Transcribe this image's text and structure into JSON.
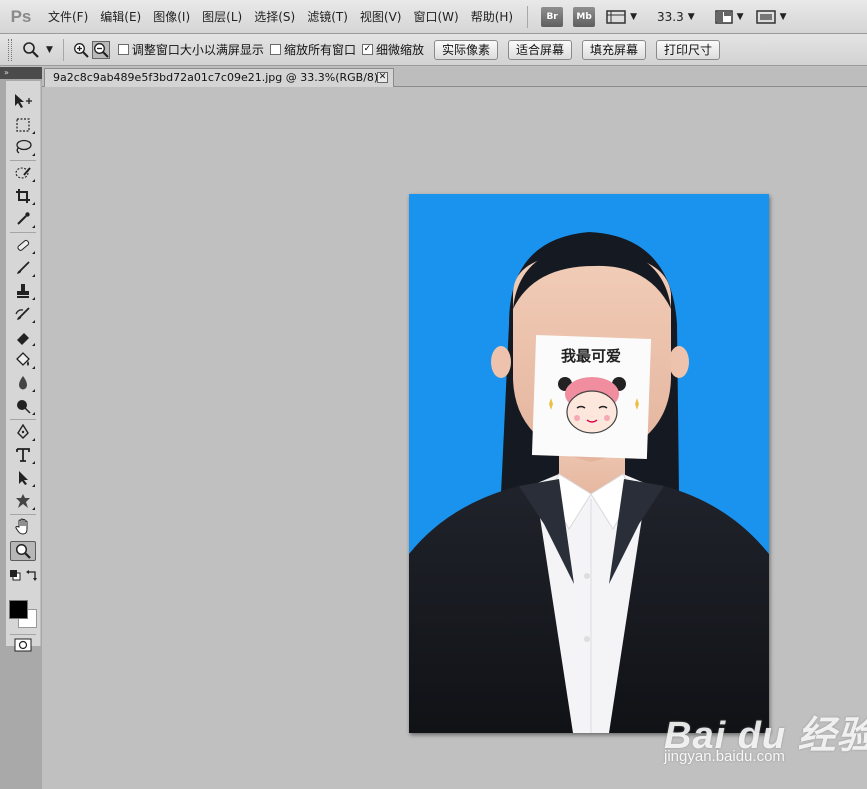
{
  "app": {
    "logo": "Ps"
  },
  "menu": [
    "文件(F)",
    "编辑(E)",
    "图像(I)",
    "图层(L)",
    "选择(S)",
    "滤镜(T)",
    "视图(V)",
    "窗口(W)",
    "帮助(H)"
  ],
  "menubar_buttons": {
    "bridge": "Br",
    "mini_bridge": "Mb",
    "zoom_level": "33.3"
  },
  "options": {
    "resize_windows_label": "调整窗口大小以满屏显示",
    "resize_windows_checked": false,
    "zoom_all_label": "缩放所有窗口",
    "zoom_all_checked": false,
    "scrubby_zoom_label": "细微缩放",
    "scrubby_zoom_checked": true,
    "actual_pixels": "实际像素",
    "fit_screen": "适合屏幕",
    "fill_screen": "填充屏幕",
    "print_size": "打印尺寸"
  },
  "toolbox_header": "»",
  "tools": [
    "move-icon",
    "marquee-icon",
    "lasso-icon",
    "quick-selection-icon",
    "crop-icon",
    "eyedropper-icon",
    "healing-brush-icon",
    "brush-icon",
    "clone-stamp-icon",
    "history-brush-icon",
    "eraser-icon",
    "paint-bucket-icon",
    "blur-icon",
    "dodge-icon",
    "pen-icon",
    "type-icon",
    "path-selection-icon",
    "custom-shape-icon",
    "hand-icon",
    "zoom-icon"
  ],
  "selected_tool": "zoom-icon",
  "document": {
    "tab_title": "9a2c8c9ab489e5f3bd72a01c7c09e21.jpg @ 33.3%(RGB/8)",
    "sticker_text": "我最可爱",
    "background_color": "#1993EE"
  },
  "colors": {
    "foreground": "#000000",
    "background": "#FFFFFF"
  },
  "watermark": {
    "logo": "Bai du 经验",
    "url": "jingyan.baidu.com"
  }
}
